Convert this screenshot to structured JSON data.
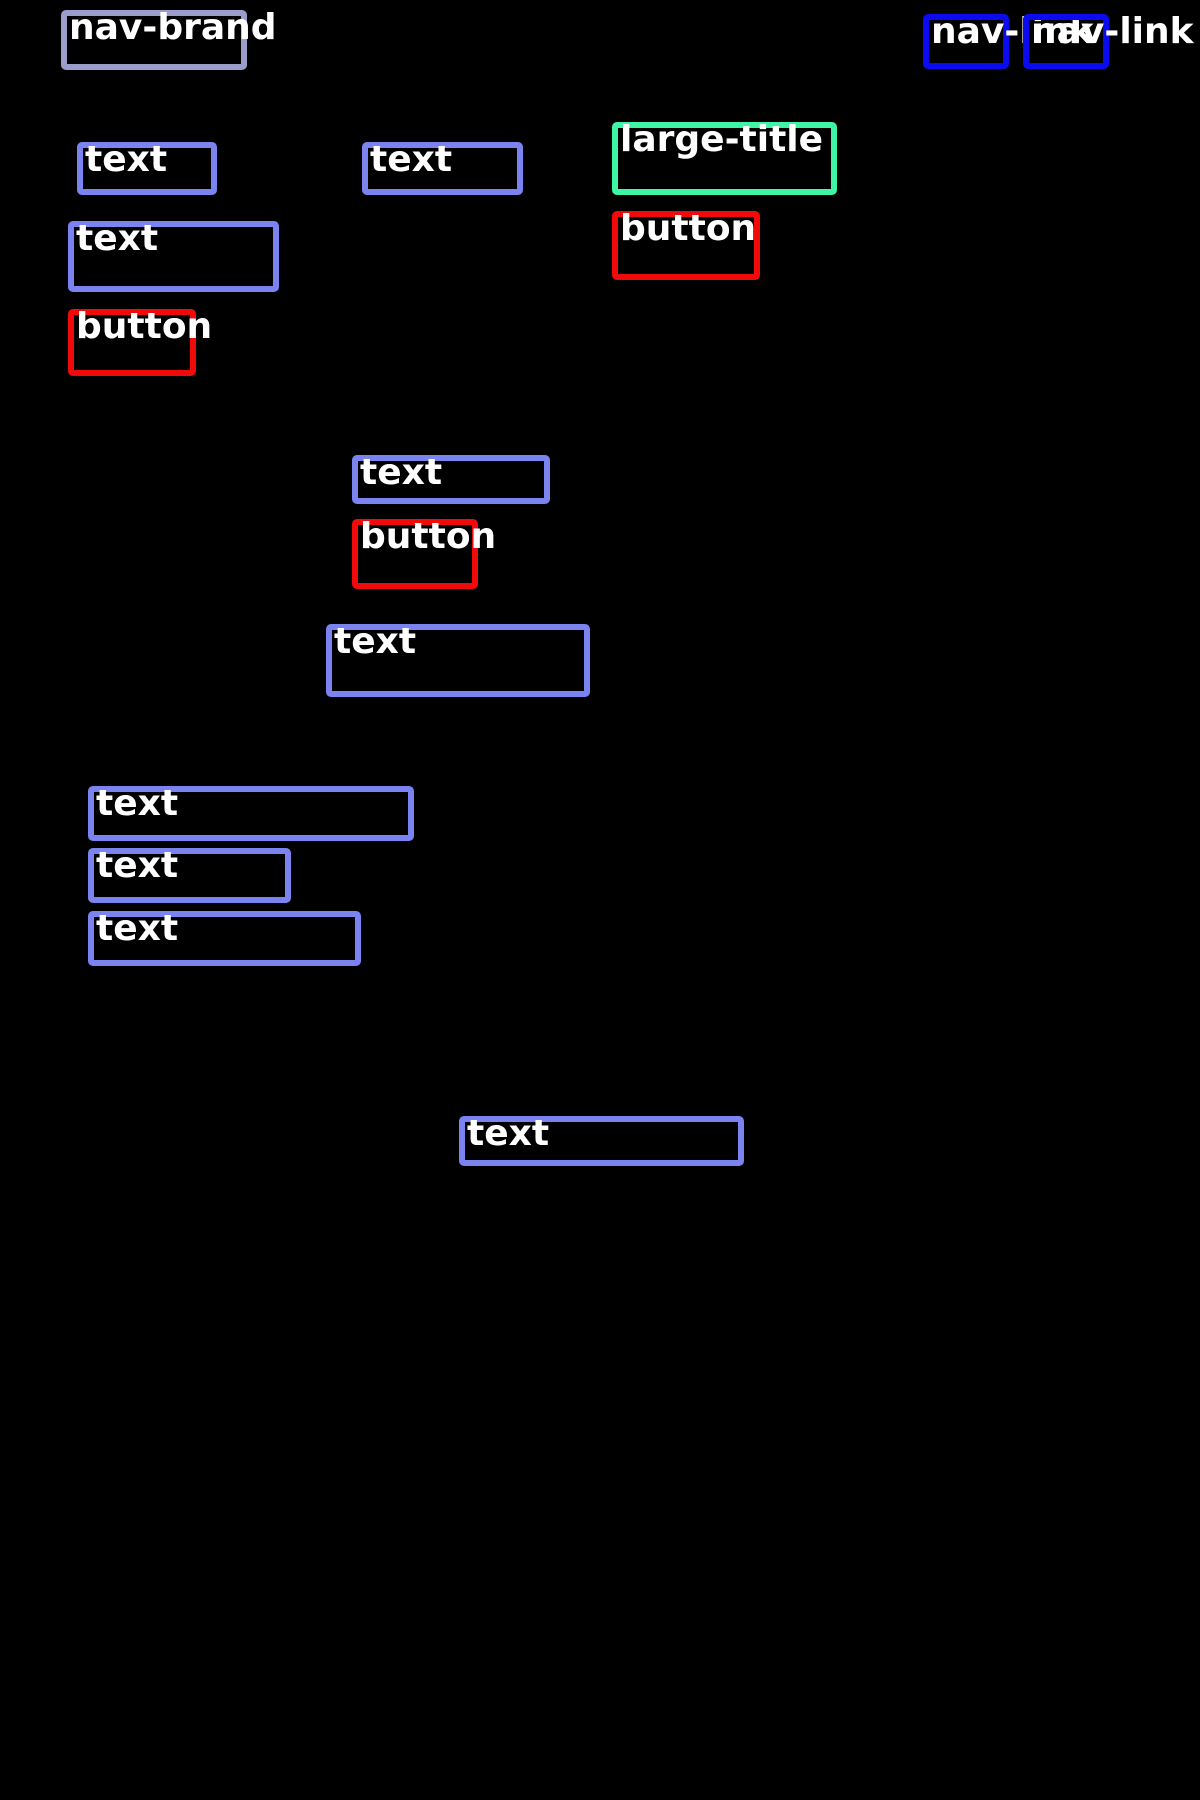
{
  "header": {
    "brand": "nav-brand",
    "links": [
      "nav-link",
      "nav-link"
    ]
  },
  "left_column": {
    "text_1": "text",
    "text_2": "text",
    "button": "button"
  },
  "middle_top": {
    "text": "text"
  },
  "hero": {
    "title": "large-title",
    "button": "button"
  },
  "center_block": {
    "text": "text",
    "button": "button"
  },
  "center_text": "text",
  "list": [
    "text",
    "text",
    "text"
  ],
  "bottom_text": "text"
}
